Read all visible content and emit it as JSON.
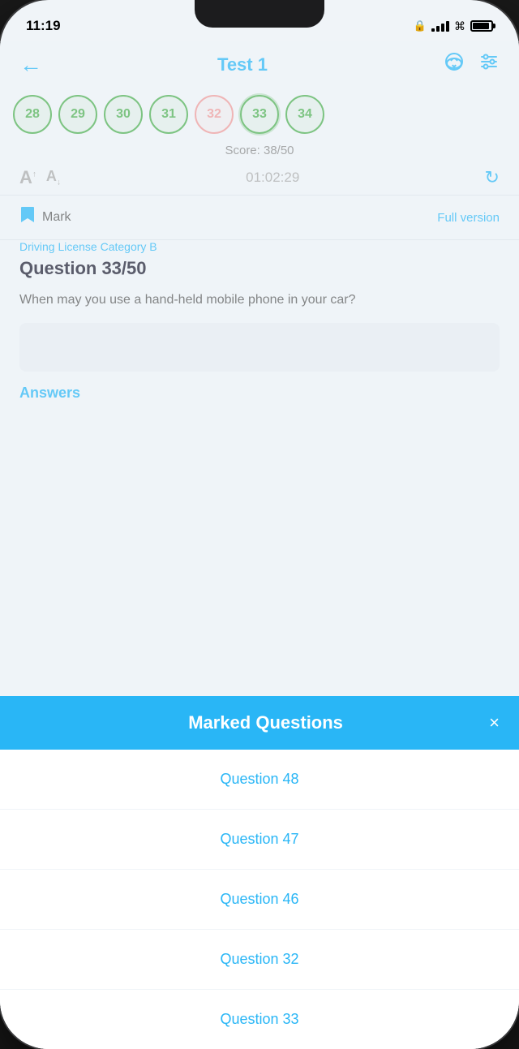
{
  "statusBar": {
    "time": "11:19",
    "signalBars": [
      4,
      6,
      9,
      12
    ],
    "batteryLevel": "90%"
  },
  "header": {
    "backLabel": "‹",
    "title": "Test 1",
    "syncIconLabel": "☁",
    "settingsIconLabel": "⚙"
  },
  "questionsStrip": {
    "questions": [
      {
        "num": "28",
        "state": "correct"
      },
      {
        "num": "29",
        "state": "correct"
      },
      {
        "num": "30",
        "state": "correct"
      },
      {
        "num": "31",
        "state": "correct"
      },
      {
        "num": "32",
        "state": "wrong"
      },
      {
        "num": "33",
        "state": "active"
      },
      {
        "num": "34",
        "state": "correct"
      }
    ]
  },
  "scoreRow": {
    "label": "Score: 38/50"
  },
  "controls": {
    "fontUpLabel": "A",
    "fontDownLabel": "A",
    "timer": "01:02:29",
    "refreshLabel": "↻"
  },
  "markRow": {
    "markLabel": "Mark",
    "fullVersionLabel": "Full version"
  },
  "question": {
    "categoryLabel": "Driving License Category B",
    "questionNumber": "Question 33/50",
    "questionText": "When may you use a hand-held mobile phone in your car?"
  },
  "answersSection": {
    "label": "Answers"
  },
  "modal": {
    "title": "Marked Questions",
    "closeLabel": "×",
    "items": [
      {
        "label": "Question 48"
      },
      {
        "label": "Question 47"
      },
      {
        "label": "Question 46"
      },
      {
        "label": "Question 32"
      },
      {
        "label": "Question 33"
      }
    ]
  }
}
